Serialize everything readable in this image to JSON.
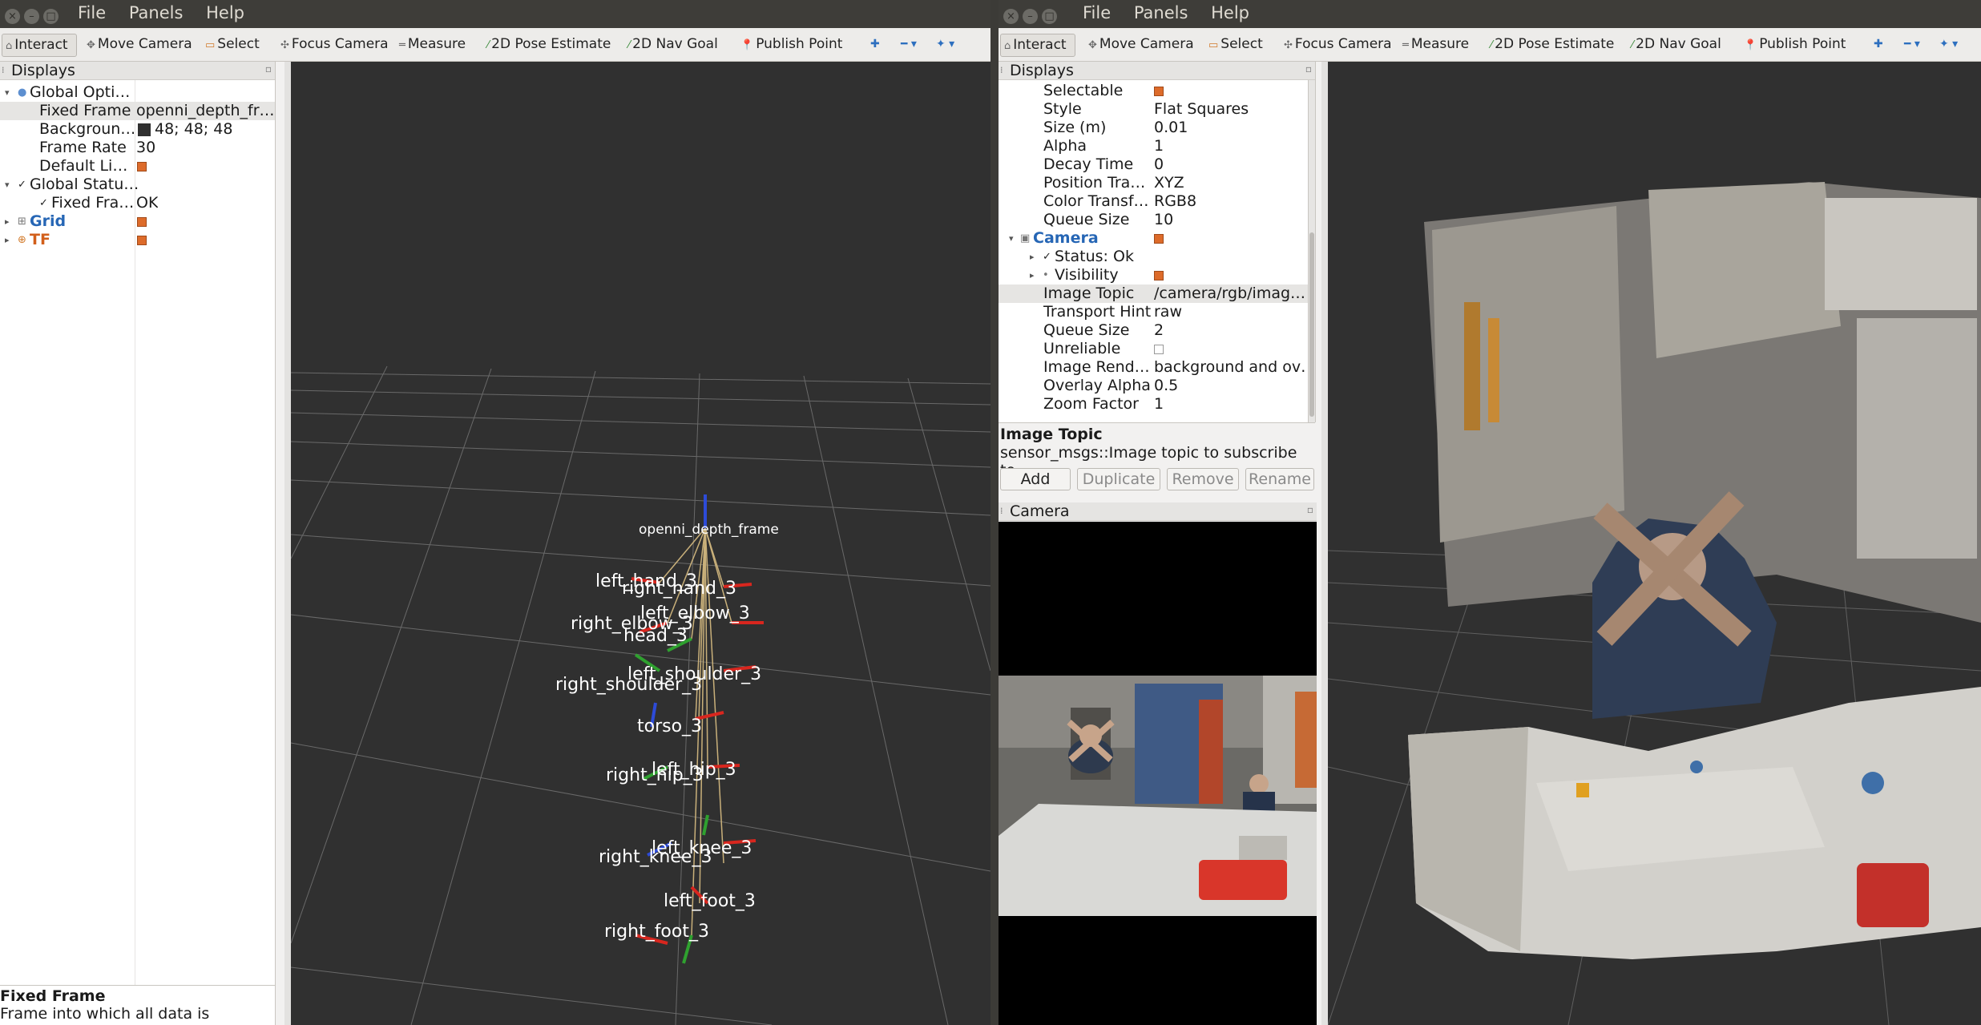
{
  "left_window": {
    "menu": [
      "File",
      "Panels",
      "Help"
    ],
    "toolbar": {
      "interact": "Interact",
      "move_camera": "Move Camera",
      "select": "Select",
      "focus_camera": "Focus Camera",
      "measure": "Measure",
      "pose_estimate": "2D Pose Estimate",
      "nav_goal": "2D Nav Goal",
      "publish_point": "Publish Point"
    },
    "displays_panel": {
      "title": "Displays",
      "rows": [
        {
          "key": "Global Opti…",
          "value": ""
        },
        {
          "key": "Fixed Frame",
          "value": "openni_depth_fr…"
        },
        {
          "key": "Backgroun…",
          "value": "48; 48; 48",
          "swatch": "#303030"
        },
        {
          "key": "Frame Rate",
          "value": "30"
        },
        {
          "key": "Default Li…",
          "value": ""
        },
        {
          "key": "Global Statu…",
          "value": ""
        },
        {
          "key": "Fixed Fra…",
          "value": "OK"
        },
        {
          "key": "Grid",
          "value": ""
        },
        {
          "key": "TF",
          "value": ""
        }
      ],
      "description_title": "Fixed Frame",
      "description_text": "Frame into which all data is"
    },
    "tf_frames": {
      "root": "openni_depth_frame",
      "labels": [
        "left_hand_3",
        "right_hand_3",
        "left_elbow_3",
        "right_elbow_3",
        "head_3",
        "left_shoulder_3",
        "right_shoulder_3",
        "torso_3",
        "left_hip_3",
        "right_hip_3",
        "left_knee_3",
        "right_knee_3",
        "left_foot_3",
        "right_foot_3"
      ]
    }
  },
  "right_window": {
    "menu": [
      "File",
      "Panels",
      "Help"
    ],
    "toolbar": {
      "interact": "Interact",
      "move_camera": "Move Camera",
      "select": "Select",
      "focus_camera": "Focus Camera",
      "measure": "Measure",
      "pose_estimate": "2D Pose Estimate",
      "nav_goal": "2D Nav Goal",
      "publish_point": "Publish Point"
    },
    "displays_panel": {
      "title": "Displays",
      "rows": [
        {
          "key": "Selectable",
          "value": ""
        },
        {
          "key": "Style",
          "value": "Flat Squares"
        },
        {
          "key": "Size (m)",
          "value": "0.01"
        },
        {
          "key": "Alpha",
          "value": "1"
        },
        {
          "key": "Decay Time",
          "value": "0"
        },
        {
          "key": "Position Tra…",
          "value": "XYZ"
        },
        {
          "key": "Color Transf…",
          "value": "RGB8"
        },
        {
          "key": "Queue Size",
          "value": "10"
        },
        {
          "key": "Camera",
          "value": ""
        },
        {
          "key": "Status: Ok",
          "value": ""
        },
        {
          "key": "Visibility",
          "value": ""
        },
        {
          "key": "Image Topic",
          "value": "/camera/rgb/imag…"
        },
        {
          "key": "Transport Hint",
          "value": "raw"
        },
        {
          "key": "Queue Size",
          "value": "2"
        },
        {
          "key": "Unreliable",
          "value": ""
        },
        {
          "key": "Image Rend…",
          "value": "background and ov…"
        },
        {
          "key": "Overlay Alpha",
          "value": "0.5"
        },
        {
          "key": "Zoom Factor",
          "value": "1"
        }
      ],
      "description_title": "Image Topic",
      "description_text": "sensor_msgs::Image topic to subscribe to.",
      "buttons": [
        "Add",
        "Duplicate",
        "Remove",
        "Rename"
      ]
    },
    "camera_panel": {
      "title": "Camera"
    }
  }
}
